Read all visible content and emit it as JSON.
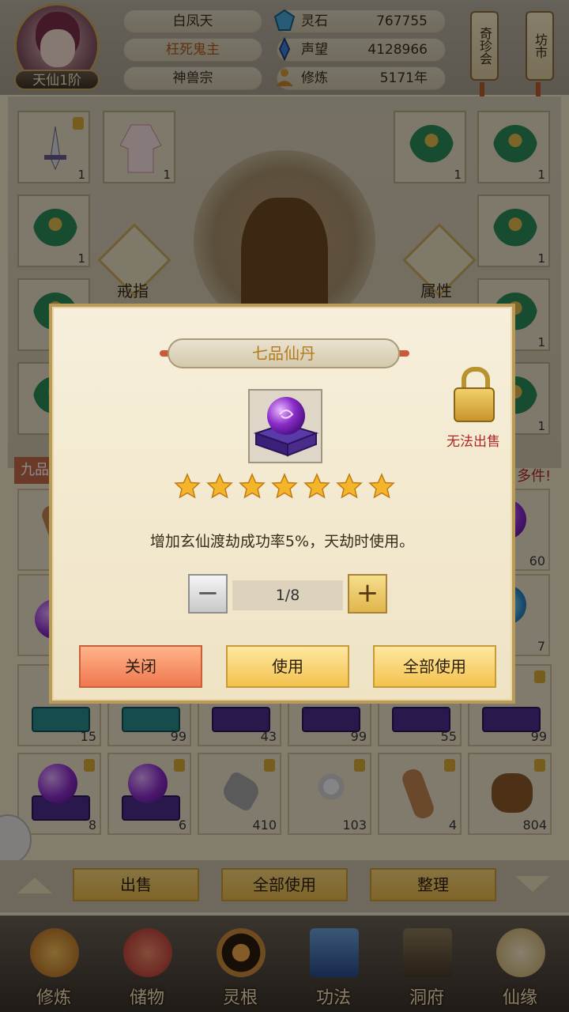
{
  "header": {
    "rank": "天仙1阶",
    "realm": "白凤天",
    "title": "枉死鬼主",
    "sect": "神兽宗",
    "stats": [
      {
        "icon": "spirit-stone-icon",
        "label": "灵石",
        "value": "767755"
      },
      {
        "icon": "reputation-icon",
        "label": "声望",
        "value": "4128966"
      },
      {
        "icon": "meditation-icon",
        "label": "修炼",
        "value": "5171年"
      }
    ],
    "buttons": {
      "treasure": "奇珍会",
      "market": "坊市"
    }
  },
  "equipment": {
    "ring_label": "戒指",
    "attr_label": "属性",
    "slot_counts": [
      "1",
      "1",
      "1",
      "1",
      "1",
      "1",
      "1",
      "1",
      "1",
      "1",
      "1"
    ]
  },
  "behind": {
    "category_partial": "九品",
    "notice_partial": "多件!"
  },
  "inventory": {
    "row1_counts": [
      "60",
      "7"
    ],
    "row2_counts": [
      "15",
      "99",
      "43",
      "99",
      "55",
      "99"
    ],
    "row3_counts": [
      "8",
      "6",
      "410",
      "103",
      "4",
      "804"
    ]
  },
  "actionbar": {
    "sell": "出售",
    "use_all": "全部使用",
    "sort": "整理"
  },
  "nav": [
    {
      "icon": "cultivate-icon",
      "label": "修炼"
    },
    {
      "icon": "storage-bag-icon",
      "label": "储物"
    },
    {
      "icon": "spirit-root-icon",
      "label": "灵根"
    },
    {
      "icon": "technique-book-icon",
      "label": "功法"
    },
    {
      "icon": "cave-dwelling-icon",
      "label": "洞府"
    },
    {
      "icon": "destiny-gourd-icon",
      "label": "仙缘"
    }
  ],
  "dialog": {
    "title": "七品仙丹",
    "lock_label": "无法出售",
    "stars": 7,
    "description": "增加玄仙渡劫成功率5%，天劫时使用。",
    "quantity": "1/8",
    "minus": "−",
    "plus": "+",
    "buttons": {
      "close": "关闭",
      "use": "使用",
      "use_all": "全部使用"
    }
  },
  "colors": {
    "accent_gold": "#f3c24e",
    "close_orange": "#f07850",
    "lock_red": "#b02828"
  }
}
